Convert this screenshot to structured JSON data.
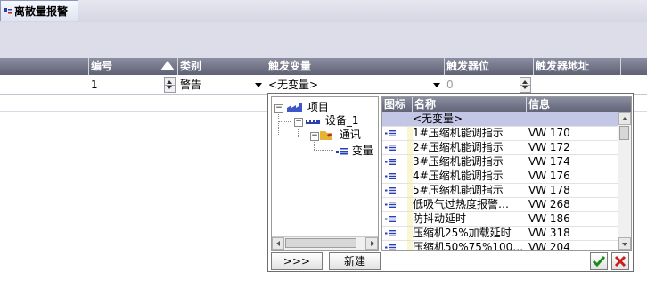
{
  "tab": {
    "title": "离散量报警"
  },
  "columns": {
    "id": "编号",
    "category": "类别",
    "trigger_var": "触发变量",
    "trigger_bit": "触发器位",
    "trigger_addr": "触发器地址"
  },
  "row": {
    "id": "1",
    "category": "警告",
    "trigger_var": "<无变量>",
    "trigger_bit": "0"
  },
  "tree": {
    "items": [
      {
        "label": "项目"
      },
      {
        "label": "设备_1"
      },
      {
        "label": "通讯"
      },
      {
        "label": "变量"
      }
    ]
  },
  "var_grid": {
    "headers": {
      "icon": "图标",
      "name": "名称",
      "info": "信息"
    },
    "rows": [
      {
        "name": "<无变量>",
        "info": ""
      },
      {
        "name": "1#压缩机能调指示",
        "info": "VW 170"
      },
      {
        "name": "2#压缩机能调指示",
        "info": "VW 172"
      },
      {
        "name": "3#压缩机能调指示",
        "info": "VW 174"
      },
      {
        "name": "4#压缩机能调指示",
        "info": "VW 176"
      },
      {
        "name": "5#压缩机能调指示",
        "info": "VW 178"
      },
      {
        "name": "低吸气过热度报警…",
        "info": "VW 268"
      },
      {
        "name": "防抖动延时",
        "info": "VW 186"
      },
      {
        "name": "压缩机25%加载延时",
        "info": "VW 318"
      },
      {
        "name": "压缩机50%75%100…",
        "info": "VW 204"
      }
    ]
  },
  "buttons": {
    "more": ">>>",
    "new": "新建"
  },
  "colors": {
    "header": "#6f7185",
    "selected_row": "#c4c6e6",
    "ok_green": "#1a8a1a",
    "cancel_red": "#c81e1e"
  }
}
